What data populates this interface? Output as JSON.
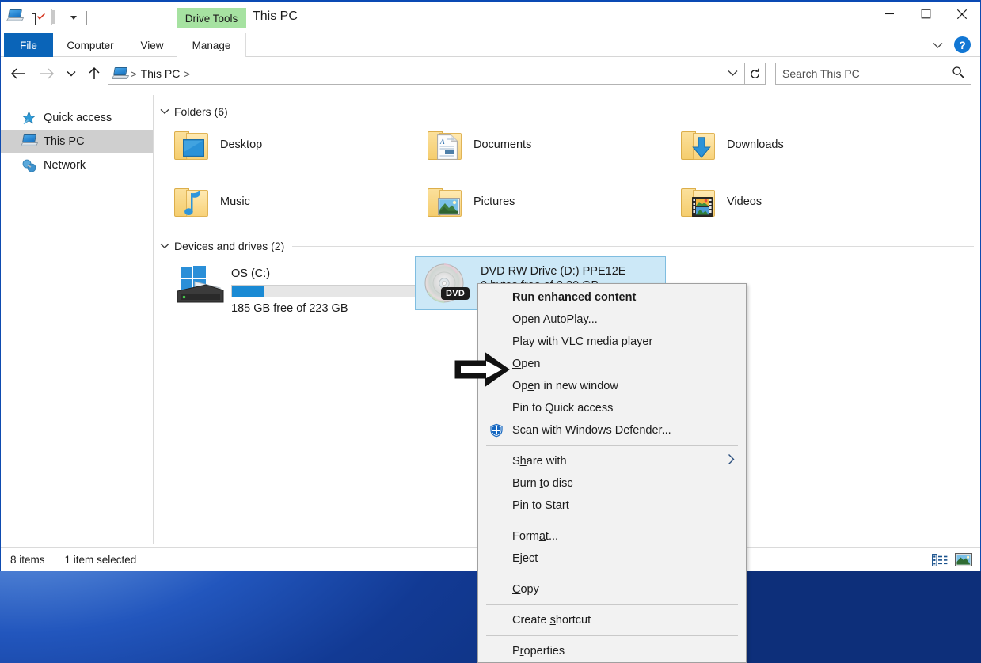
{
  "window": {
    "title": "This PC",
    "contextual_tab_group": "Drive Tools",
    "quick_access_icons": [
      "this-pc-icon",
      "properties-icon",
      "new-folder-icon",
      "customize-qat-caret-icon"
    ],
    "controls": {
      "minimize": "minimize-icon",
      "maximize": "maximize-icon",
      "close": "close-icon"
    },
    "help_label": "?"
  },
  "ribbon": {
    "tabs": [
      {
        "label": "File",
        "name": "tab-file"
      },
      {
        "label": "Computer",
        "name": "tab-computer"
      },
      {
        "label": "View",
        "name": "tab-view"
      },
      {
        "label": "Manage",
        "name": "tab-manage"
      }
    ]
  },
  "address": {
    "crumb_icon": "this-pc-icon",
    "crumb": "This PC",
    "sep1": ">",
    "sep2": ">",
    "dropdown_icon": "chevron-down-icon",
    "refresh_icon": "refresh-icon"
  },
  "search": {
    "placeholder": "Search This PC",
    "icon": "search-icon"
  },
  "sidebar": {
    "items": [
      {
        "label": "Quick access",
        "icon": "pin-star-icon",
        "selected": false
      },
      {
        "label": "This PC",
        "icon": "this-pc-icon",
        "selected": true
      },
      {
        "label": "Network",
        "icon": "network-icon",
        "selected": false
      }
    ]
  },
  "main": {
    "groups": [
      {
        "title": "Folders (6)",
        "chevron": "chevron-down-icon"
      },
      {
        "title": "Devices and drives (2)",
        "chevron": "chevron-down-icon"
      }
    ],
    "folders": [
      {
        "label": "Desktop",
        "icon": "folder-desktop-icon"
      },
      {
        "label": "Documents",
        "icon": "folder-documents-icon"
      },
      {
        "label": "Downloads",
        "icon": "folder-downloads-icon"
      },
      {
        "label": "Music",
        "icon": "folder-music-icon"
      },
      {
        "label": "Pictures",
        "icon": "folder-pictures-icon"
      },
      {
        "label": "Videos",
        "icon": "folder-videos-icon"
      }
    ],
    "drives": [
      {
        "name": "OS (C:)",
        "free_text": "185 GB free of 223 GB",
        "used_percent": 17,
        "bar_color": "#1a8ad4",
        "icon": "hard-drive-icon",
        "selected": false
      },
      {
        "name": "DVD RW Drive (D:) PPE12E",
        "free_text": "0 bytes free of 2.30 GB",
        "icon": "dvd-drive-icon",
        "badge": "DVD",
        "selected": true
      }
    ]
  },
  "statusbar": {
    "item_count": "8 items",
    "selection": "1 item selected",
    "view_buttons": [
      {
        "name": "details-view-button",
        "icon": "details-view-icon"
      },
      {
        "name": "large-icons-view-button",
        "icon": "large-icons-view-icon"
      }
    ]
  },
  "context_menu": {
    "items": [
      {
        "label": "Run enhanced content",
        "bold": true,
        "icon": null,
        "submenu": false
      },
      {
        "label": "Open AutoPlay...",
        "bold": false,
        "icon": null,
        "submenu": false,
        "accel": "P"
      },
      {
        "label": "Play with VLC media player",
        "bold": false,
        "icon": null,
        "submenu": false
      },
      {
        "label": "Open",
        "bold": false,
        "icon": null,
        "submenu": false,
        "accel": "O"
      },
      {
        "label": "Open in new window",
        "bold": false,
        "icon": null,
        "submenu": false,
        "accel": "e"
      },
      {
        "label": "Pin to Quick access",
        "bold": false,
        "icon": null,
        "submenu": false
      },
      {
        "label": "Scan with Windows Defender...",
        "bold": false,
        "icon": "windows-defender-shield-icon",
        "submenu": false
      },
      {
        "separator": true
      },
      {
        "label": "Share with",
        "bold": false,
        "icon": null,
        "submenu": true,
        "accel": "h"
      },
      {
        "label": "Burn to disc",
        "bold": false,
        "icon": null,
        "submenu": false,
        "accel": "t"
      },
      {
        "label": "Pin to Start",
        "bold": false,
        "icon": null,
        "submenu": false,
        "accel": "P"
      },
      {
        "separator": true
      },
      {
        "label": "Format...",
        "bold": false,
        "icon": null,
        "submenu": false,
        "accel": "a"
      },
      {
        "label": "Eject",
        "bold": false,
        "icon": null,
        "submenu": false,
        "accel": "j"
      },
      {
        "separator": true
      },
      {
        "label": "Copy",
        "bold": false,
        "icon": null,
        "submenu": false,
        "accel": "C"
      },
      {
        "separator": true
      },
      {
        "label": "Create shortcut",
        "bold": false,
        "icon": null,
        "submenu": false,
        "accel": "s"
      },
      {
        "separator": true
      },
      {
        "label": "Properties",
        "bold": false,
        "icon": null,
        "submenu": false,
        "accel": "r"
      }
    ]
  },
  "annotation": {
    "arrow": "right-arrow-annotation",
    "points_at": "Open"
  },
  "colors": {
    "accent_blue": "#0a64b8",
    "selection_blue": "#cce8f7",
    "contextual_tab_green": "#a6e2a1",
    "drive_bar_blue": "#1a8ad4",
    "desktop_blue": "#17439f"
  }
}
